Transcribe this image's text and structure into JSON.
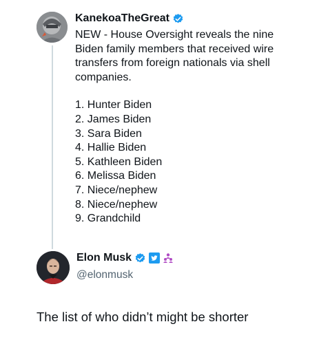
{
  "original_tweet": {
    "author_name": "KanekoaTheGreat",
    "verified_icon": "blue-verified-check-icon",
    "text": "NEW - House Oversight reveals the nine Biden family members that received wire transfers from foreign nationals via shell companies.",
    "list": [
      "1. Hunter Biden",
      "2. James Biden",
      "3. Sara Biden",
      "4. Hallie Biden",
      "5. Kathleen Biden",
      "6. Melissa Biden",
      "7. Niece/nephew",
      "8. Niece/nephew",
      "9. Grandchild"
    ]
  },
  "reply": {
    "author_name": "Elon Musk",
    "handle": "@elonmusk",
    "badges": [
      "blue-verified-check-icon",
      "twitter-logo-badge-icon",
      "affiliate-people-icon"
    ],
    "text": "The list of who didn’t might be shorter"
  },
  "colors": {
    "text": "#0f1419",
    "secondary_text": "#536471",
    "verified_blue": "#1d9bf0",
    "affiliate_purple": "#b04bc4",
    "thread_line": "#cfd9de"
  }
}
